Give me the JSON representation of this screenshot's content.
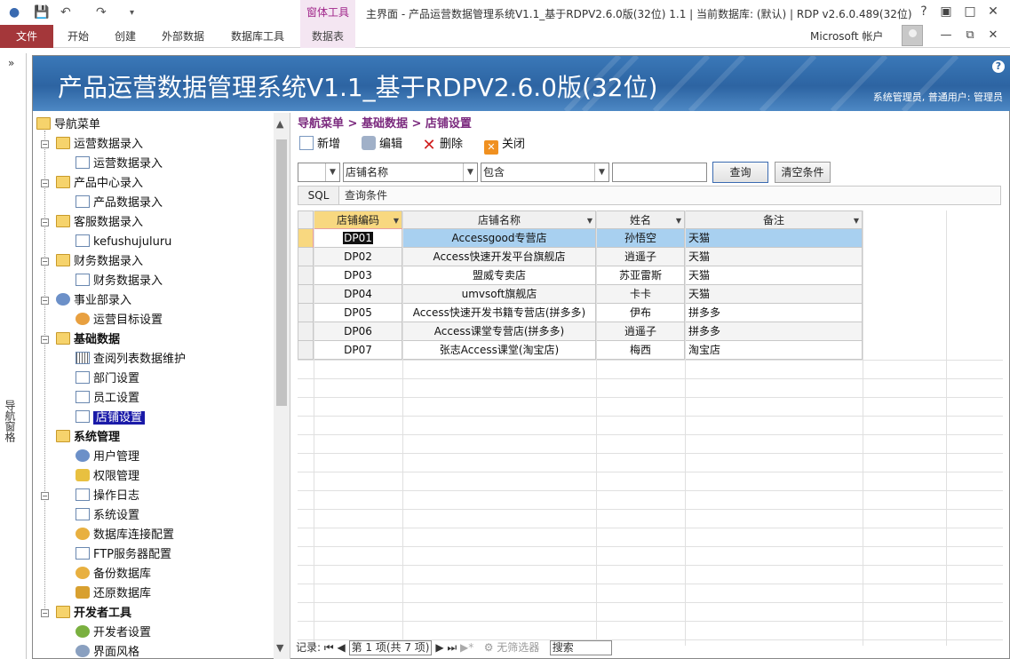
{
  "window": {
    "title": "主界面 - 产品运营数据管理系统V1.1_基于RDPV2.6.0版(32位) 1.1 | 当前数据库: (默认) | RDP v2.6.0.489(32位)",
    "context_group": "窗体工具",
    "account": "Microsoft 帐户"
  },
  "ribbon": {
    "file_tab": "文件",
    "tabs": [
      "开始",
      "创建",
      "外部数据",
      "数据库工具"
    ],
    "context_tab": "数据表"
  },
  "nav_pane": {
    "label": "导航窗格"
  },
  "banner": {
    "title": "产品运营数据管理系统V1.1_基于RDPV2.6.0版(32位)",
    "user_info": "系统管理员, 普通用户: 管理员"
  },
  "tree": {
    "root": "导航菜单",
    "nodes": [
      {
        "label": "运营数据录入"
      },
      {
        "label": "运营数据录入"
      },
      {
        "label": "产品中心录入"
      },
      {
        "label": "产品数据录入"
      },
      {
        "label": "客服数据录入"
      },
      {
        "label": "kefushujuluru"
      },
      {
        "label": "财务数据录入"
      },
      {
        "label": "财务数据录入"
      },
      {
        "label": "事业部录入"
      },
      {
        "label": "运营目标设置"
      },
      {
        "label": "基础数据"
      },
      {
        "label": "查阅列表数据维护"
      },
      {
        "label": "部门设置"
      },
      {
        "label": "员工设置"
      },
      {
        "label": "店铺设置"
      },
      {
        "label": "系统管理"
      },
      {
        "label": "用户管理"
      },
      {
        "label": "权限管理"
      },
      {
        "label": "操作日志"
      },
      {
        "label": "系统设置"
      },
      {
        "label": "数据库连接配置"
      },
      {
        "label": "FTP服务器配置"
      },
      {
        "label": "备份数据库"
      },
      {
        "label": "还原数据库"
      },
      {
        "label": "开发者工具"
      },
      {
        "label": "开发者设置"
      },
      {
        "label": "界面风格"
      }
    ]
  },
  "breadcrumb": "导航菜单 > 基础数据 > 店铺设置",
  "toolbar": {
    "new": "新增",
    "edit": "编辑",
    "delete": "删除",
    "close": "关闭"
  },
  "filter": {
    "field": "店铺名称",
    "operator": "包含",
    "value": "",
    "query_button": "查询",
    "clear_button": "清空条件",
    "sql_button": "SQL",
    "sql_placeholder": "查询条件"
  },
  "table": {
    "columns": [
      "店铺编码",
      "店铺名称",
      "姓名",
      "备注"
    ],
    "rows": [
      [
        "DP01",
        "Accessgood专营店",
        "孙悟空",
        "天猫"
      ],
      [
        "DP02",
        "Access快速开发平台旗舰店",
        "逍遥子",
        "天猫"
      ],
      [
        "DP03",
        "盟威专卖店",
        "苏亚雷斯",
        "天猫"
      ],
      [
        "DP04",
        "umvsoft旗舰店",
        "卡卡",
        "天猫"
      ],
      [
        "DP05",
        "Access快速开发书籍专营店(拼多多)",
        "伊布",
        "拼多多"
      ],
      [
        "DP06",
        "Access课堂专营店(拼多多)",
        "逍遥子",
        "拼多多"
      ],
      [
        "DP07",
        "张志Access课堂(淘宝店)",
        "梅西",
        "淘宝店"
      ]
    ]
  },
  "record_nav": {
    "label": "记录:",
    "position": "第 1 项(共 7 项)",
    "filter_status": "无筛选器",
    "search": "搜索"
  },
  "colors": {
    "file_tab": "#a4373a",
    "context": "#a0268a",
    "banner": "#2d64a2",
    "selected_tree": "#1a1aa8",
    "selected_row": "#a8d0f0"
  }
}
